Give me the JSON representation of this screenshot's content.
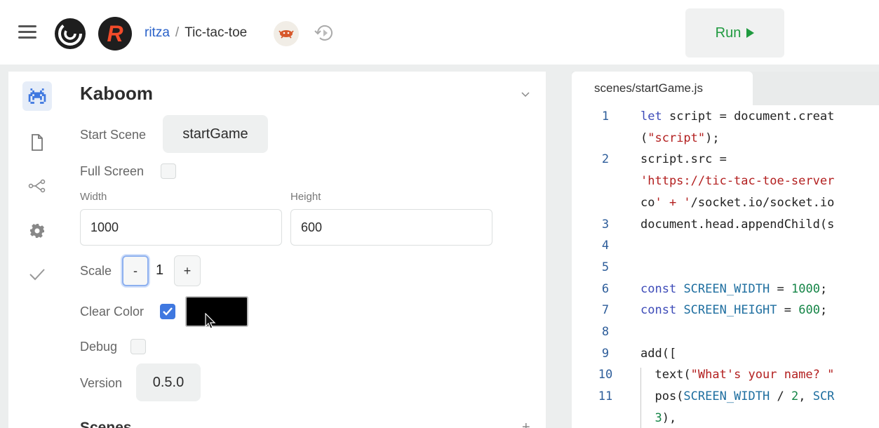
{
  "header": {
    "user": "ritza",
    "separator": "/",
    "repl_name": "Tic-tac-toe",
    "avatar_letter": "R",
    "run_label": "Run"
  },
  "sidebar": {
    "items": [
      {
        "icon": "space-invader-icon",
        "active": true
      },
      {
        "icon": "file-icon",
        "active": false
      },
      {
        "icon": "share-icon",
        "active": false
      },
      {
        "icon": "gear-icon",
        "active": false
      },
      {
        "icon": "check-icon",
        "active": false
      }
    ]
  },
  "kaboom": {
    "title": "Kaboom",
    "start_scene_label": "Start Scene",
    "start_scene_value": "startGame",
    "full_screen_label": "Full Screen",
    "width_label": "Width",
    "width_value": "1000",
    "height_label": "Height",
    "height_value": "600",
    "scale_label": "Scale",
    "scale_minus": "-",
    "scale_value": "1",
    "scale_plus": "+",
    "clear_color_label": "Clear Color",
    "clear_color_value": "#000000",
    "debug_label": "Debug",
    "version_label": "Version",
    "version_value": "0.5.0",
    "scenes_label": "Scenes"
  },
  "editor": {
    "tab_label": "scenes/startGame.js",
    "lines": [
      {
        "n": "1",
        "text": "let script = document.creat"
      },
      {
        "n": "",
        "text": "(\"script\");"
      },
      {
        "n": "2",
        "text": "script.src ="
      },
      {
        "n": "",
        "text": "'https://tic-tac-toe-server"
      },
      {
        "n": "",
        "text": "co' + '/socket.io/socket.io"
      },
      {
        "n": "3",
        "text": "document.head.appendChild(s"
      },
      {
        "n": "4",
        "text": ""
      },
      {
        "n": "5",
        "text": ""
      },
      {
        "n": "6",
        "text": "const SCREEN_WIDTH = 1000;"
      },
      {
        "n": "7",
        "text": "const SCREEN_HEIGHT = 600;"
      },
      {
        "n": "8",
        "text": ""
      },
      {
        "n": "9",
        "text": "add(["
      },
      {
        "n": "10",
        "text": "  text(\"What's your name? \""
      },
      {
        "n": "11",
        "text": "  pos(SCREEN_WIDTH / 2, SCR"
      },
      {
        "n": "",
        "text": "  3),"
      }
    ]
  },
  "colors": {
    "accent": "#3f78e0",
    "run_green": "#1f9a3f",
    "link_blue": "#2a62c9",
    "avatar_red": "#f24b2a"
  }
}
